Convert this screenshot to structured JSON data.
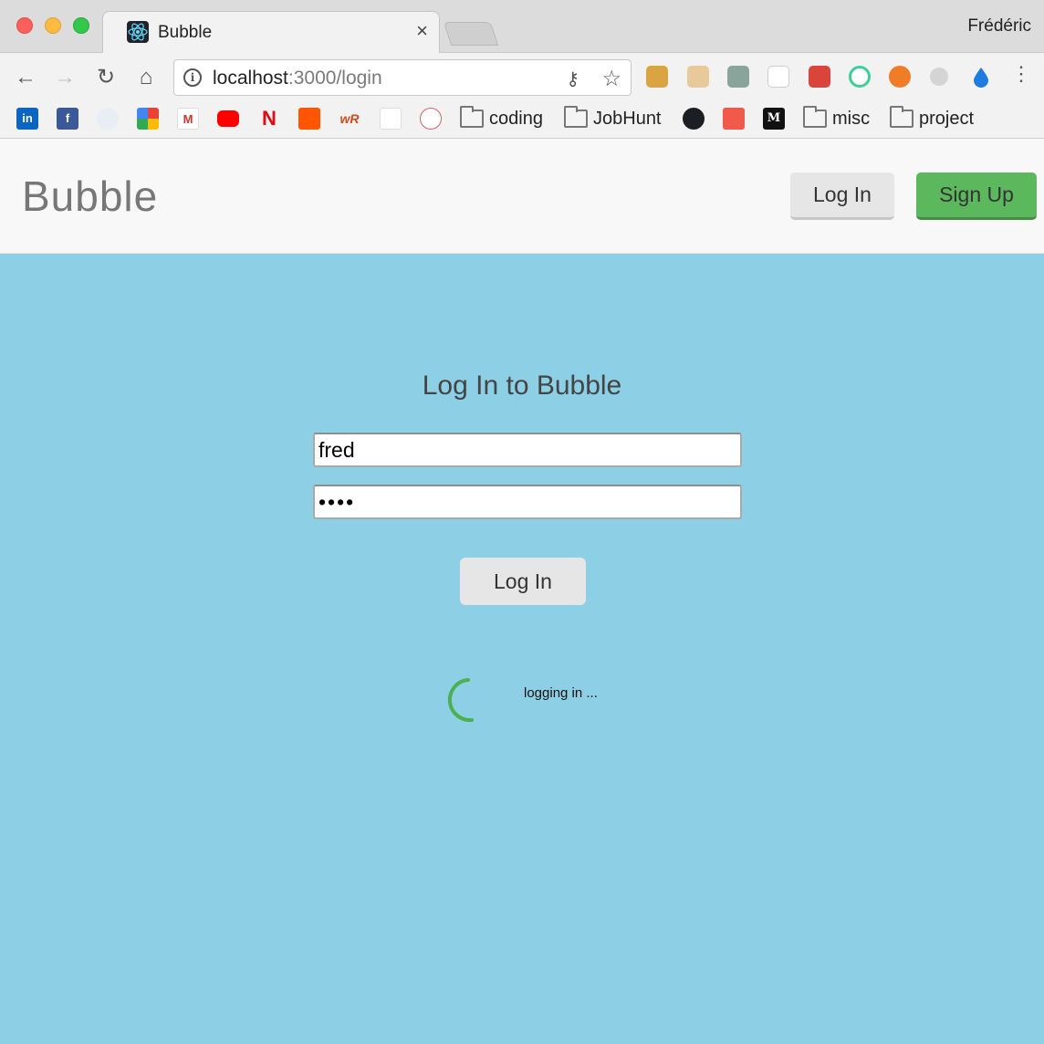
{
  "browser": {
    "tab_title": "Bubble",
    "tab_close": "×",
    "profile_name": "Frédéric",
    "url_host": "localhost",
    "url_path": ":3000/login",
    "icons": {
      "back": "←",
      "forward": "→",
      "reload": "↻",
      "home": "⌂",
      "info": "i",
      "key": "⚷",
      "star": "☆",
      "menu": "⋮"
    }
  },
  "bookmarks": {
    "folders": [
      "coding",
      "JobHunt",
      "misc",
      "project"
    ],
    "linkedin": "in",
    "facebook": "f",
    "gmail": "M",
    "netflix": "N",
    "medium": "M",
    "wordreference": "wR"
  },
  "navbar": {
    "brand": "Bubble",
    "login_label": "Log In",
    "signup_label": "Sign Up"
  },
  "login_form": {
    "title": "Log In to Bubble",
    "username_value": "fred",
    "password_value": "••••",
    "submit_label": "Log In",
    "status_text": "logging in ..."
  },
  "colors": {
    "page_background": "#8dcfe5",
    "signup_green": "#5cb85c",
    "spinner_green": "#4caf50"
  }
}
